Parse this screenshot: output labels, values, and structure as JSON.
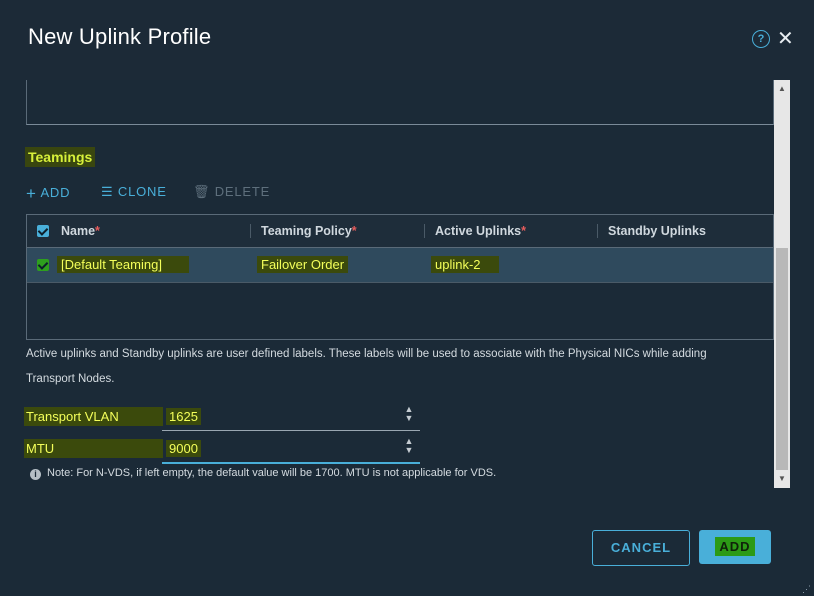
{
  "dialog": {
    "title": "New Uplink Profile"
  },
  "teamings": {
    "section_title": "Teamings",
    "toolbar": {
      "add": "ADD",
      "clone": "CLONE",
      "delete": "DELETE"
    },
    "columns": {
      "name": "Name",
      "teaming_policy": "Teaming Policy",
      "active_uplinks": "Active Uplinks",
      "standby_uplinks": "Standby Uplinks"
    },
    "required_marker": "*",
    "rows": [
      {
        "name": "[Default Teaming]",
        "teaming_policy": "Failover Order",
        "active_uplinks": "uplink-2",
        "standby_uplinks": ""
      }
    ],
    "info_text": "Active uplinks and Standby uplinks are user defined labels. These labels will be used to associate with the Physical NICs while adding Transport Nodes."
  },
  "transport_vlan": {
    "label": "Transport VLAN",
    "value": "1625"
  },
  "mtu": {
    "label": "MTU",
    "value": "9000",
    "note": "Note: For N-VDS, if left empty, the default value will be 1700. MTU is not applicable for VDS."
  },
  "footer": {
    "cancel": "CANCEL",
    "add": "ADD"
  },
  "colors": {
    "accent": "#49afd9",
    "highlight": "#f4ff5a",
    "background": "#1b2a37"
  },
  "icons": {
    "help": "help-circle-icon",
    "close": "close-icon",
    "add": "plus-icon",
    "clone": "clone-icon",
    "delete": "trash-icon",
    "info": "info-icon"
  }
}
